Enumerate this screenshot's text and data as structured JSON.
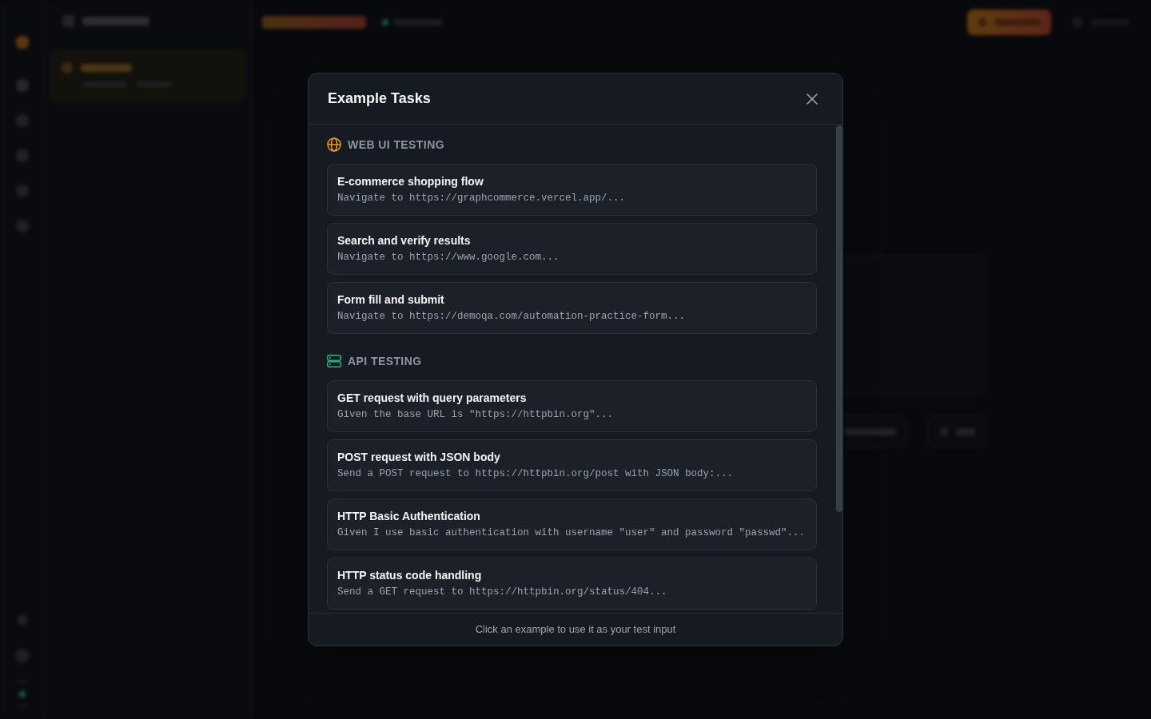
{
  "modal": {
    "title": "Example Tasks",
    "sections": [
      {
        "kind": "web",
        "color": "#f59e0b",
        "title": "WEB UI TESTING",
        "examples": [
          {
            "title": "E-commerce shopping flow",
            "description": "Navigate to https://graphcommerce.vercel.app/..."
          },
          {
            "title": "Search and verify results",
            "description": "Navigate to https://www.google.com..."
          },
          {
            "title": "Form fill and submit",
            "description": "Navigate to https://demoqa.com/automation-practice-form..."
          }
        ]
      },
      {
        "kind": "api",
        "color": "#10b981",
        "title": "API TESTING",
        "examples": [
          {
            "title": "GET request with query parameters",
            "description": "Given the base URL is \"https://httpbin.org\"..."
          },
          {
            "title": "POST request with JSON body",
            "description": "Send a POST request to https://httpbin.org/post with JSON body:..."
          },
          {
            "title": "HTTP Basic Authentication",
            "description": "Given I use basic authentication with username \"user\" and password \"passwd\"..."
          },
          {
            "title": "HTTP status code handling",
            "description": "Send a GET request to https://httpbin.org/status/404..."
          }
        ]
      }
    ],
    "footer": "Click an example to use it as your test input"
  }
}
